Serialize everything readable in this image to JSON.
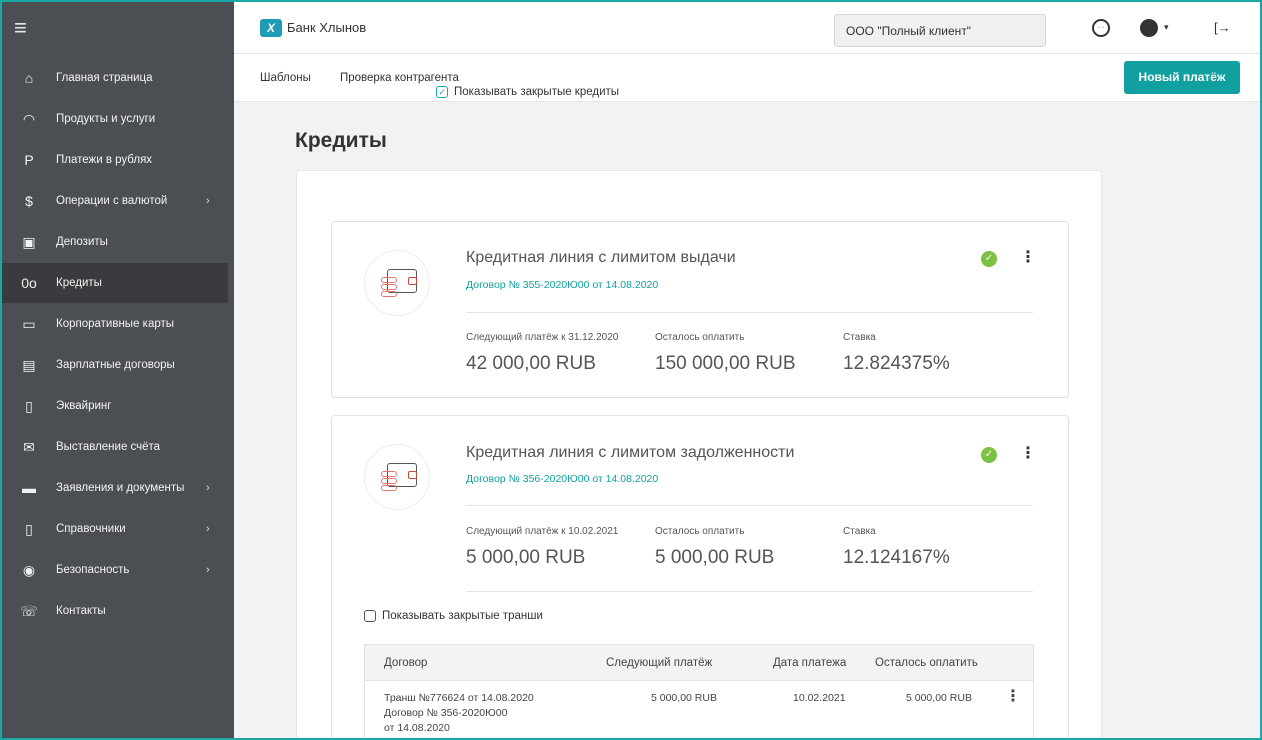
{
  "header": {
    "bank_name": "Банк Хлынов",
    "client_name": "ООО \"Полный клиент\""
  },
  "sidebar": {
    "items": [
      {
        "label": "Главная страница",
        "icon": "home-icon",
        "glyph": "⌂"
      },
      {
        "label": "Продукты и услуги",
        "icon": "bag-icon",
        "glyph": "◠"
      },
      {
        "label": "Платежи в рублях",
        "icon": "ruble-icon",
        "glyph": "Р"
      },
      {
        "label": "Операции с валютой",
        "icon": "dollar-icon",
        "glyph": "$",
        "chevron": "›"
      },
      {
        "label": "Депозиты",
        "icon": "deposit-icon",
        "glyph": "▣"
      },
      {
        "label": "Кредиты",
        "icon": "credit-icon",
        "glyph": "0о",
        "active": true
      },
      {
        "label": "Корпоративные карты",
        "icon": "card-icon",
        "glyph": "▭"
      },
      {
        "label": "Зарплатные договоры",
        "icon": "salary-icon",
        "glyph": "▤"
      },
      {
        "label": "Эквайринг",
        "icon": "terminal-icon",
        "glyph": "▯"
      },
      {
        "label": "Выставление счёта",
        "icon": "invoice-icon",
        "glyph": "✉"
      },
      {
        "label": "Заявления и документы",
        "icon": "folder-icon",
        "glyph": "▬",
        "chevron": "›"
      },
      {
        "label": "Справочники",
        "icon": "book-icon",
        "glyph": "▯",
        "chevron": "›"
      },
      {
        "label": "Безопасность",
        "icon": "shield-icon",
        "glyph": "◉",
        "chevron": "›"
      },
      {
        "label": "Контакты",
        "icon": "phone-icon",
        "glyph": "☏"
      }
    ]
  },
  "subheader": {
    "templates": "Шаблоны",
    "counterparty_check": "Проверка контрагента",
    "show_closed_credits": "Показывать закрытые кредиты",
    "new_payment": "Новый платёж"
  },
  "page": {
    "title": "Кредиты"
  },
  "credits": [
    {
      "title": "Кредитная линия с лимитом выдачи",
      "contract": "Договор № 355-2020Ю00 от 14.08.2020",
      "next_payment_label": "Следующий платёж к 31.12.2020",
      "next_payment": "42 000,00 RUB",
      "remaining_label": "Осталось оплатить",
      "remaining": "150 000,00 RUB",
      "rate_label": "Ставка",
      "rate": "12.824375%"
    },
    {
      "title": "Кредитная линия с лимитом задолженности",
      "contract": "Договор № 356-2020Ю00 от 14.08.2020",
      "next_payment_label": "Следующий платёж к 10.02.2021",
      "next_payment": "5 000,00 RUB",
      "remaining_label": "Осталось оплатить",
      "remaining": "5 000,00 RUB",
      "rate_label": "Ставка",
      "rate": "12.124167%"
    }
  ],
  "tranches": {
    "show_closed": "Показывать закрытые транши",
    "columns": [
      "Договор",
      "Следующий платёж",
      "Дата платежа",
      "Осталось оплатить"
    ],
    "rows": [
      {
        "line1": "Транш №776624 от 14.08.2020",
        "line2": "Договор № 356-2020Ю00",
        "line3": "от 14.08.2020",
        "next_payment": "5 000,00 RUB",
        "date": "10.02.2021",
        "remaining": "5 000,00 RUB"
      }
    ]
  }
}
